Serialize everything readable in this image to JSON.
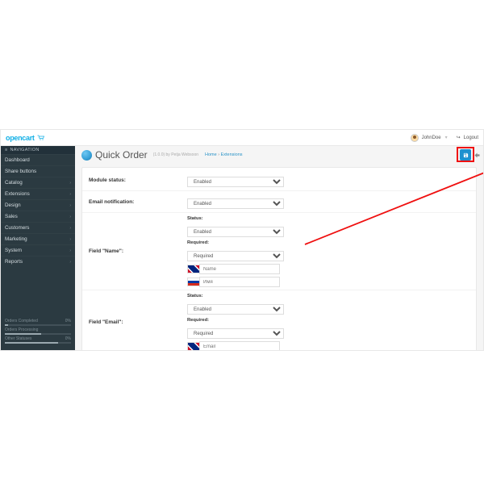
{
  "brand": {
    "name": "opencart"
  },
  "topbar": {
    "user": "JohnDoe",
    "logout": "Logout"
  },
  "sidebar": {
    "heading": "NAVIGATION",
    "items": [
      "Dashboard",
      "Share buttons",
      "Catalog",
      "Extensions",
      "Design",
      "Sales",
      "Customers",
      "Marketing",
      "System",
      "Reports"
    ],
    "stats": [
      {
        "label": "Orders Completed",
        "value": "0%"
      },
      {
        "label": "Orders Processing",
        "value": ""
      },
      {
        "label": "Other Statuses",
        "value": "0%"
      }
    ]
  },
  "page": {
    "title": "Quick Order",
    "meta": "(1.0.0) by Petja Websoon",
    "breadcrumb": [
      "Home",
      "Extensions"
    ]
  },
  "form": {
    "sub": {
      "status": "Status:",
      "required": "Required:"
    },
    "module_status": {
      "label": "Module status:",
      "value": "Enabled"
    },
    "email_notification": {
      "label": "Email notification:",
      "value": "Enabled"
    },
    "field_name": {
      "label": "Field \"Name\":",
      "status": "Enabled",
      "required": "Required",
      "en": "Name",
      "ru": "Имя"
    },
    "field_email": {
      "label": "Field \"Email\":",
      "status": "Enabled",
      "required": "Required",
      "en": "Email"
    }
  }
}
